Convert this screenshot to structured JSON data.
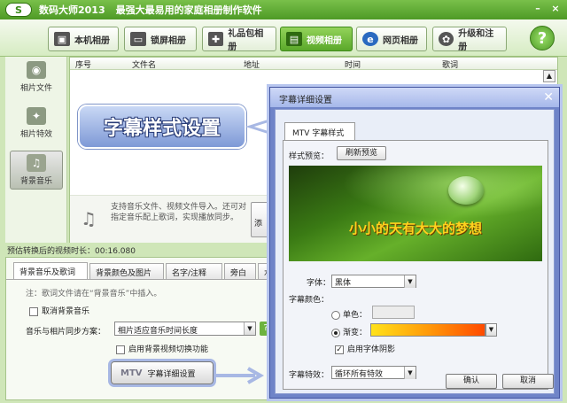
{
  "app": {
    "name": "数码大师2013",
    "slogan": "最强大最易用的家庭相册制作软件",
    "window_buttons": [
      "–",
      "×"
    ]
  },
  "toolbar": {
    "tabs": [
      {
        "label": "本机相册",
        "icon": "photo-album-icon",
        "active": false
      },
      {
        "label": "锁屏相册",
        "icon": "monitor-icon",
        "active": false
      },
      {
        "label": "礼品包相册",
        "icon": "gift-icon",
        "active": false
      },
      {
        "label": "视频相册",
        "icon": "film-icon",
        "active": true
      },
      {
        "label": "网页相册",
        "icon": "globe-icon",
        "active": false
      },
      {
        "label": "升级和注册",
        "icon": "gear-icon",
        "active": false
      }
    ],
    "help": "?"
  },
  "sidebar": {
    "items": [
      {
        "label": "相片文件",
        "icon": "camera-icon"
      },
      {
        "label": "相片特效",
        "icon": "sparkle-icon"
      },
      {
        "label": "背景音乐",
        "icon": "music-note-icon",
        "active": true
      }
    ]
  },
  "table": {
    "columns": [
      "序号",
      "文件名",
      "地址",
      "时间",
      "歌词"
    ]
  },
  "drop_zone": {
    "text": "支持音乐文件、视频文件导入。还可对指定音乐配上歌词，实现播放同步。",
    "add_label": "添"
  },
  "callout": {
    "text": "字幕样式设置"
  },
  "duration": {
    "text": "预估转换后的视频时长：00:16.080"
  },
  "lower_tabs": [
    "背景音乐及歌词",
    "背景颜色及图片",
    "名字/注释",
    "旁白",
    "水"
  ],
  "music_panel": {
    "note": "注：歌词文件请在“背景音乐”中插入。",
    "cancel_music": "取消背景音乐",
    "sync_label": "音乐与相片同步方案：",
    "sync_value": "相片适应音乐时间长度",
    "sync_help": "?",
    "bg_video_switch": "启用背景视频切换功能",
    "mtv_button_prefix": "MTV",
    "mtv_button_label": "字幕详细设置"
  },
  "dialog": {
    "title": "字幕详细设置",
    "tab": "MTV 字幕样式",
    "preview_label": "样式预览：",
    "refresh_button": "刷新预览",
    "preview_lyric": "小小的天有大大的梦想",
    "font_label": "字体：",
    "font_value": "黑体",
    "color_label": "字幕颜色：",
    "solid_label": "单色：",
    "gradient_label": "渐变：",
    "shadow_label": "启用字体阴影",
    "effect_label": "字幕特效：",
    "effect_value": "循环所有特效",
    "ok": "确认",
    "cancel": "取消",
    "close": "✕"
  },
  "colors": {
    "accent_green": "#5aa82a",
    "dialog_border": "#6f84c8",
    "lyric_yellow": "#ffd21e"
  }
}
